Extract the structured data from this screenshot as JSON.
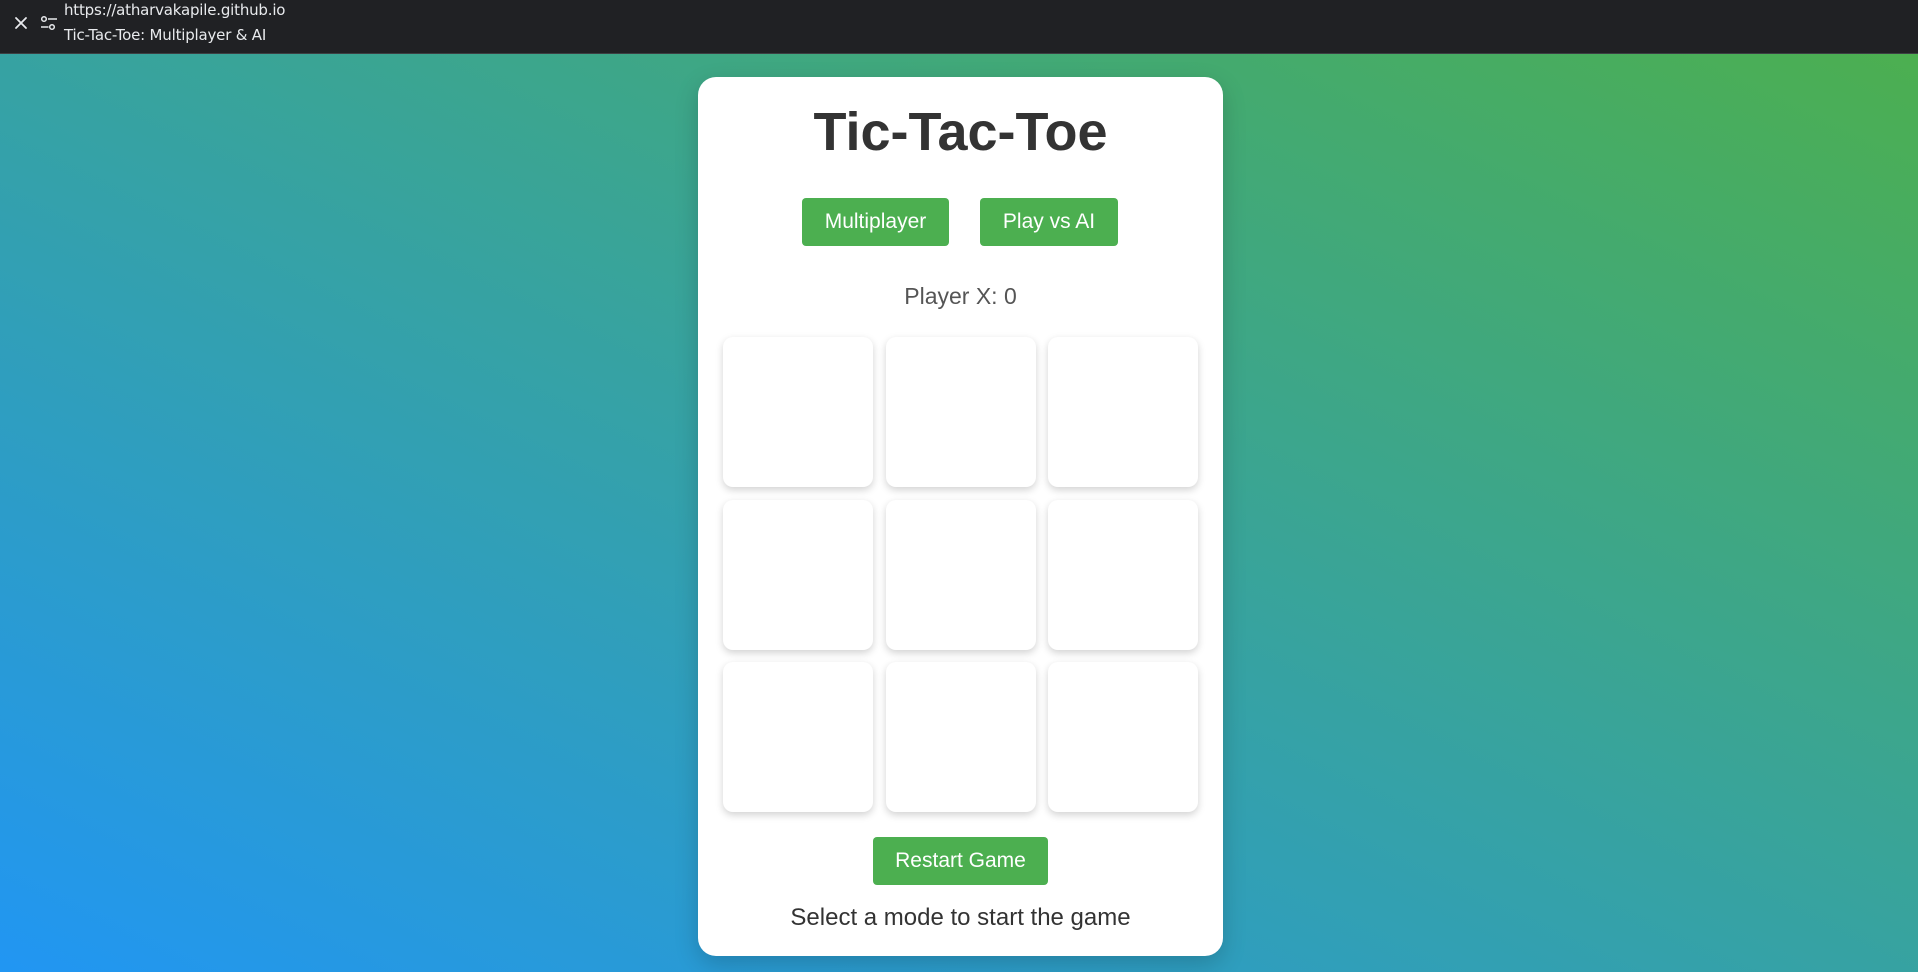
{
  "browser": {
    "url": "https://atharvakapile.github.io",
    "tab_title": "Tic-Tac-Toe: Multiplayer & AI",
    "icons": {
      "close": "close-icon",
      "site_settings": "tune-icon"
    }
  },
  "game": {
    "title": "Tic-Tac-Toe",
    "modes": {
      "multiplayer_label": "Multiplayer",
      "ai_label": "Play vs AI"
    },
    "score_text": "Player X: 0",
    "board": [
      "",
      "",
      "",
      "",
      "",
      "",
      "",
      "",
      ""
    ],
    "restart_label": "Restart Game",
    "status_text": "Select a mode to start the game"
  },
  "colors": {
    "accent": "#4caf50",
    "gradient_start": "#2196f3",
    "gradient_end": "#4caf50",
    "title_text": "#333333",
    "topbar_bg": "#202124"
  }
}
